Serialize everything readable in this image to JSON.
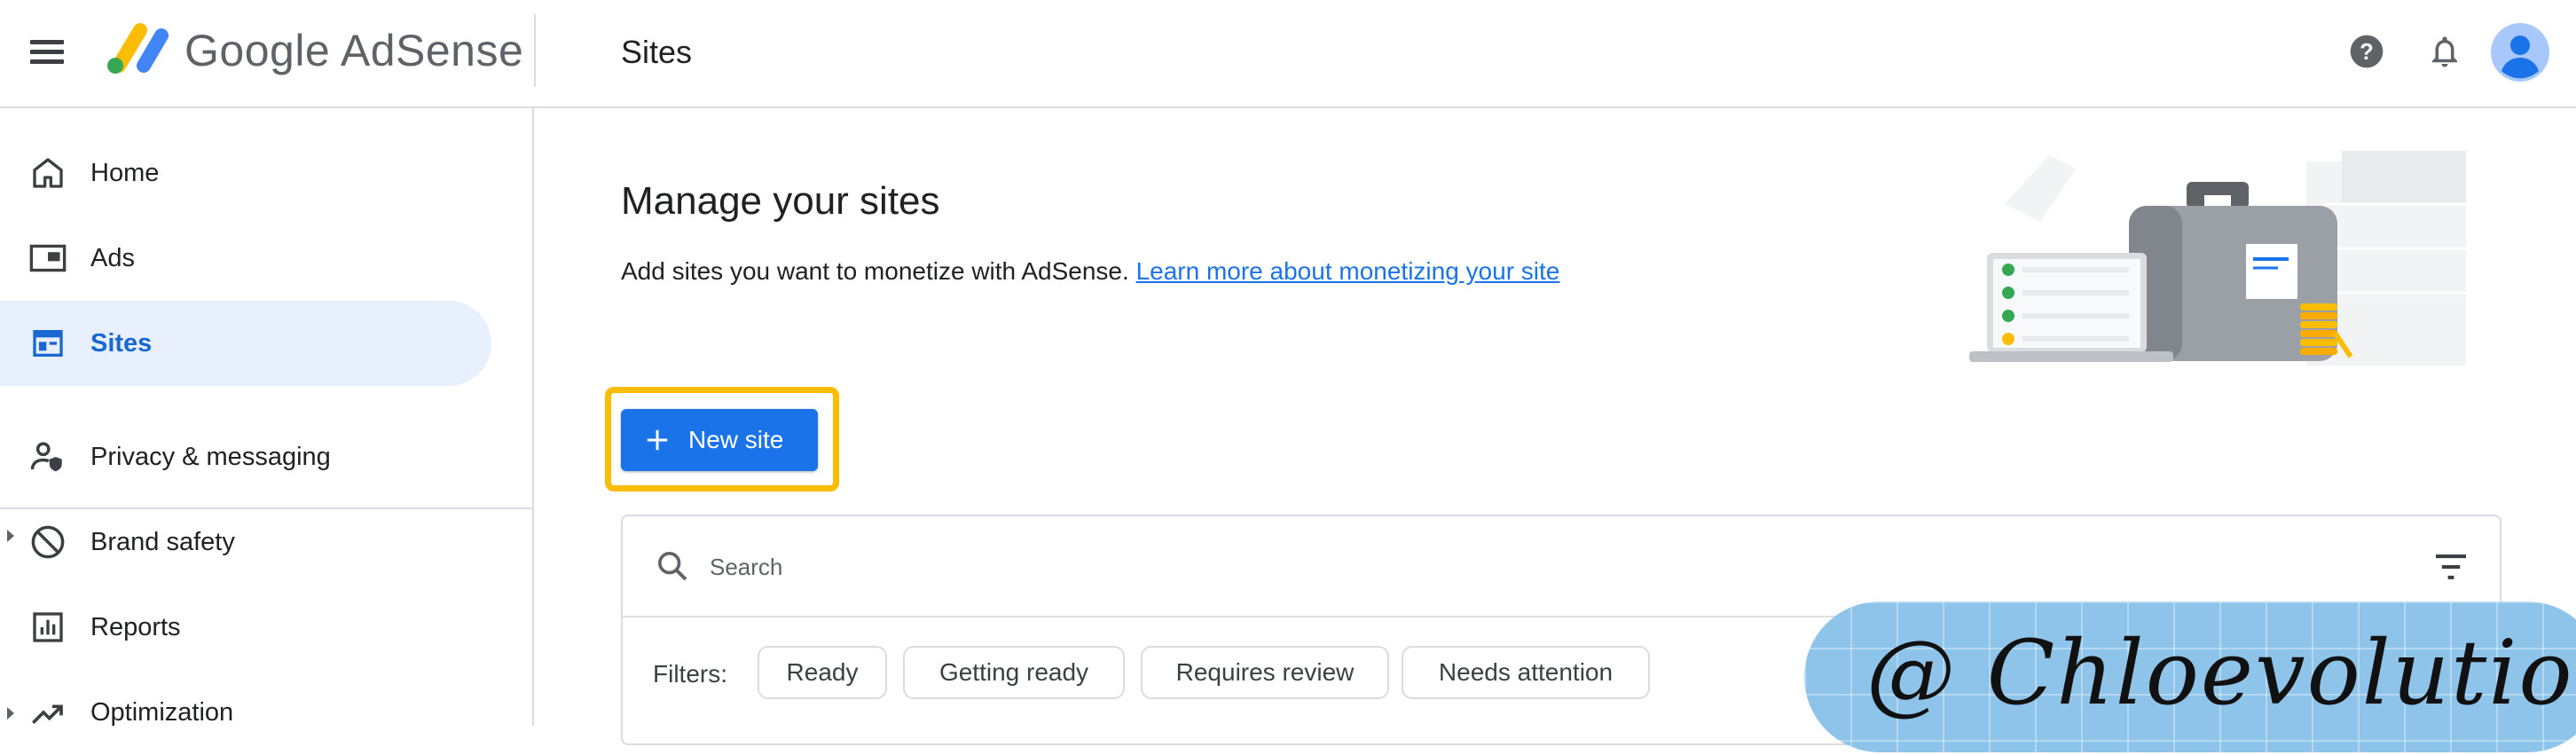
{
  "header": {
    "app_name": "Google AdSense",
    "page_title": "Sites",
    "icons": [
      "menu-icon",
      "help-icon",
      "notifications-icon",
      "account-avatar-icon"
    ]
  },
  "sidebar": {
    "items": [
      {
        "label": "Home",
        "icon": "home-icon",
        "active": false
      },
      {
        "label": "Ads",
        "icon": "ads-icon",
        "active": false
      },
      {
        "label": "Sites",
        "icon": "sites-icon",
        "active": true
      },
      {
        "label": "Privacy & messaging",
        "icon": "privacy-icon",
        "active": false
      },
      {
        "label": "Brand safety",
        "icon": "block-icon",
        "active": false,
        "expandable": true
      },
      {
        "label": "Reports",
        "icon": "reports-icon",
        "active": false
      },
      {
        "label": "Optimization",
        "icon": "trending-up-icon",
        "active": false,
        "expandable": true
      }
    ]
  },
  "main": {
    "title": "Manage your sites",
    "description": "Add sites you want to monetize with AdSense.",
    "learn_more_link": "Learn more about monetizing your site",
    "new_site_button": "New site",
    "search_placeholder": "Search",
    "filters_label": "Filters:",
    "filter_chips": [
      "Ready",
      "Getting ready",
      "Requires review",
      "Needs attention"
    ]
  },
  "watermark": "@ Chloevolution",
  "colors": {
    "primary": "#1a73e8",
    "active_nav_bg": "#e8f0fe",
    "active_nav_text": "#1967d2",
    "highlight": "#fbbc04",
    "watermark_bg": "#8ec3ea"
  }
}
